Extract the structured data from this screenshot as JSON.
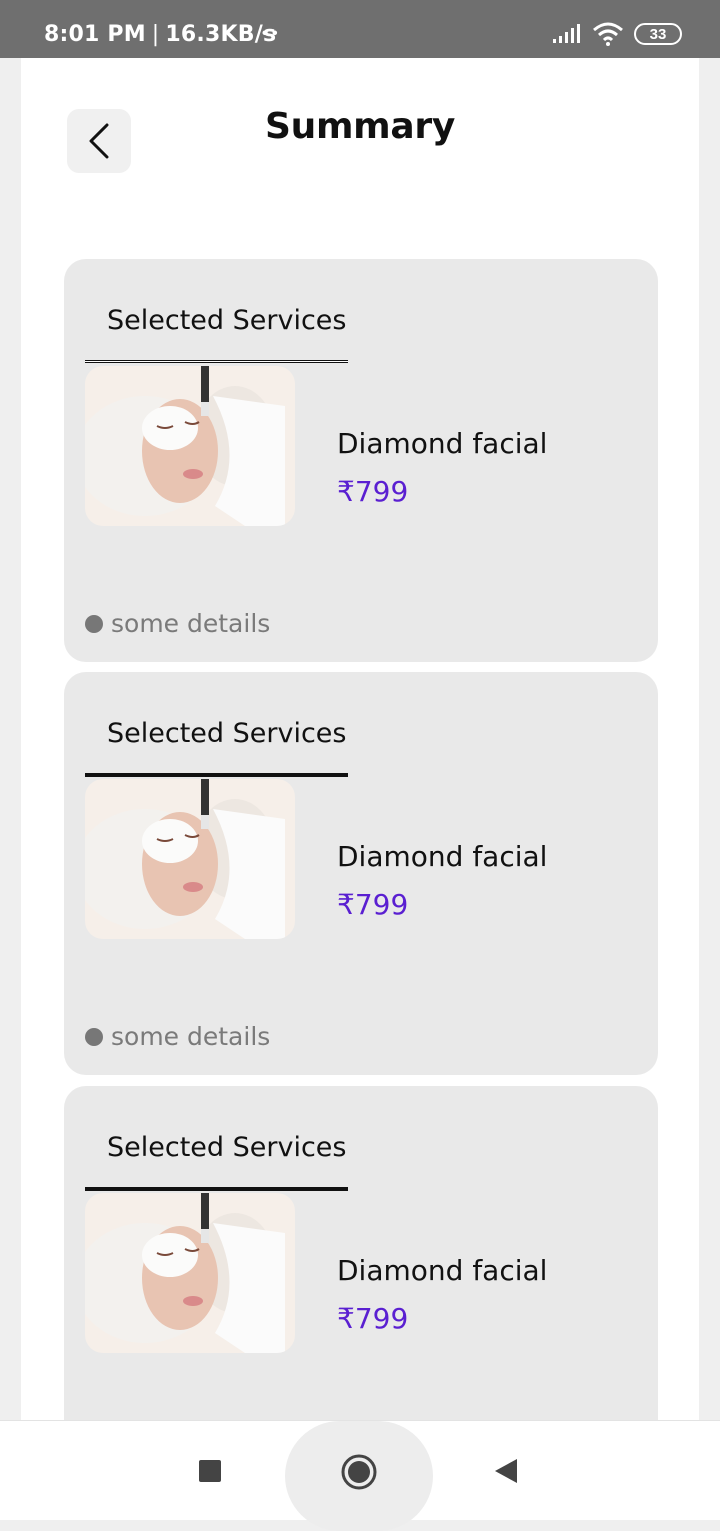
{
  "status_bar": {
    "time": "8:01 PM",
    "speed": "16.3KB/s",
    "dots": "• •",
    "battery": "33"
  },
  "header": {
    "title": "Summary"
  },
  "cards": [
    {
      "heading": "Selected Services",
      "name": "Diamond facial",
      "price": "₹799",
      "details": "some details"
    },
    {
      "heading": "Selected Services",
      "name": "Diamond facial",
      "price": "₹799",
      "details": "some details"
    },
    {
      "heading": "Selected Services",
      "name": "Diamond facial",
      "price": "₹799"
    }
  ],
  "icons": {
    "back": "chevron-left-icon",
    "signal": "signal-icon",
    "wifi": "wifi-icon",
    "recents": "square-icon",
    "home": "circle-icon",
    "nav_back": "triangle-back-icon"
  },
  "colors": {
    "price": "#5a1fd1",
    "card_bg": "#e9e9e9",
    "status_bar": "#6f6f6f"
  }
}
